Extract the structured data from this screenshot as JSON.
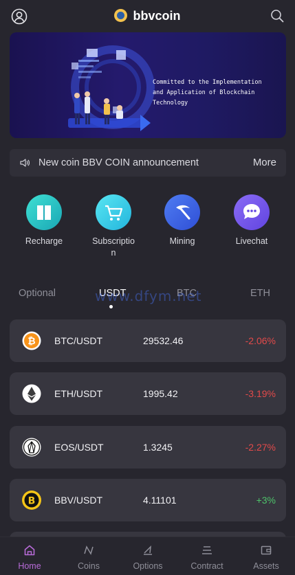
{
  "header": {
    "app_name": "bbvcoin",
    "user_icon": "user-circle-icon",
    "search_icon": "search-icon"
  },
  "banner": {
    "tagline_line1": "Committed to the Implementation",
    "tagline_line2": "and Application of Blockchain",
    "tagline_line3": "Technology"
  },
  "notice": {
    "icon": "speaker-icon",
    "text": "New coin BBV COIN announcement",
    "more_label": "More"
  },
  "shortcuts": [
    {
      "label": "Recharge",
      "icon": "book-icon"
    },
    {
      "label": "Subscriptio\nn",
      "icon": "cart-icon"
    },
    {
      "label": "Mining",
      "icon": "pickaxe-icon"
    },
    {
      "label": "Livechat",
      "icon": "chat-bubble-icon"
    }
  ],
  "tabs": [
    {
      "label": "Optional",
      "active": false
    },
    {
      "label": "USDT",
      "active": true
    },
    {
      "label": "BTC",
      "active": false
    },
    {
      "label": "ETH",
      "active": false
    }
  ],
  "watermark": "www.dfym.net",
  "market": [
    {
      "pair": "BTC/USDT",
      "price": "29532.46",
      "change": "-2.06%",
      "icon": "bitcoin-icon"
    },
    {
      "pair": "ETH/USDT",
      "price": "1995.42",
      "change": "-3.19%",
      "icon": "ethereum-icon"
    },
    {
      "pair": "EOS/USDT",
      "price": "1.3245",
      "change": "-2.27%",
      "icon": "eos-icon"
    },
    {
      "pair": "BBV/USDT",
      "price": "4.11101",
      "change": "+3%",
      "icon": "bbv-coin-icon"
    }
  ],
  "bottom_nav": [
    {
      "label": "Home",
      "icon": "home-icon",
      "active": true
    },
    {
      "label": "Coins",
      "icon": "coins-icon",
      "active": false
    },
    {
      "label": "Options",
      "icon": "options-icon",
      "active": false
    },
    {
      "label": "Contract",
      "icon": "contract-icon",
      "active": false
    },
    {
      "label": "Assets",
      "icon": "wallet-icon",
      "active": false
    }
  ],
  "colors": {
    "background": "#27262e",
    "card": "#37363f",
    "down": "#e24a4a",
    "up": "#4ec36a",
    "nav_active": "#b86bd8"
  }
}
